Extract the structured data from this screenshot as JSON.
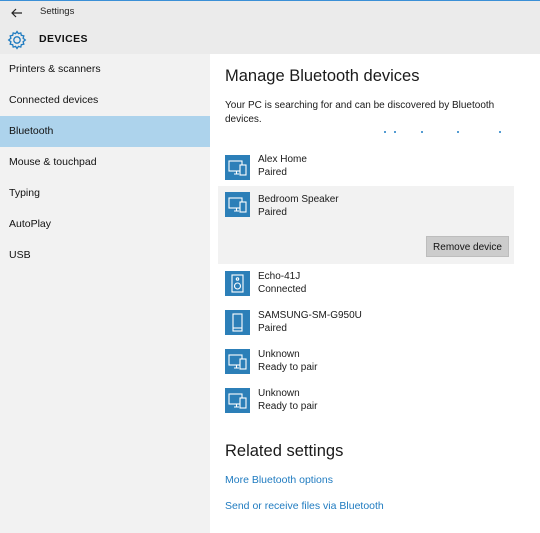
{
  "window": {
    "app_title": "Settings",
    "back_icon": "back-arrow-icon"
  },
  "header": {
    "section_title": "DEVICES",
    "icon": "gear-icon"
  },
  "colors": {
    "accent": "#1f7bc0",
    "selected_nav": "#add3ec",
    "device_icon_bg": "#2c7fb8",
    "sidebar_bg": "#f2f2f2"
  },
  "sidebar": {
    "items": [
      {
        "label": "Printers & scanners",
        "selected": false
      },
      {
        "label": "Connected devices",
        "selected": false
      },
      {
        "label": "Bluetooth",
        "selected": true
      },
      {
        "label": "Mouse & touchpad",
        "selected": false
      },
      {
        "label": "Typing",
        "selected": false
      },
      {
        "label": "AutoPlay",
        "selected": false
      },
      {
        "label": "USB",
        "selected": false
      }
    ]
  },
  "main": {
    "heading": "Manage Bluetooth devices",
    "searching_text": "Your PC is searching for and can be discovered by Bluetooth devices.",
    "devices": [
      {
        "name": "Alex Home",
        "status": "Paired",
        "icon": "phone-computer-icon"
      },
      {
        "name": "Bedroom Speaker",
        "status": "Paired",
        "icon": "phone-computer-icon",
        "selected": true,
        "action": "Remove device"
      },
      {
        "name": "Echo-41J",
        "status": "Connected",
        "icon": "speaker-icon"
      },
      {
        "name": "SAMSUNG-SM-G950U",
        "status": "Paired",
        "icon": "phone-icon"
      },
      {
        "name": "Unknown",
        "status": "Ready to pair",
        "icon": "phone-computer-icon"
      },
      {
        "name": "Unknown",
        "status": "Ready to pair",
        "icon": "phone-computer-icon"
      }
    ],
    "related": {
      "heading": "Related settings",
      "links": [
        "More Bluetooth options",
        "Send or receive files via Bluetooth"
      ]
    }
  }
}
